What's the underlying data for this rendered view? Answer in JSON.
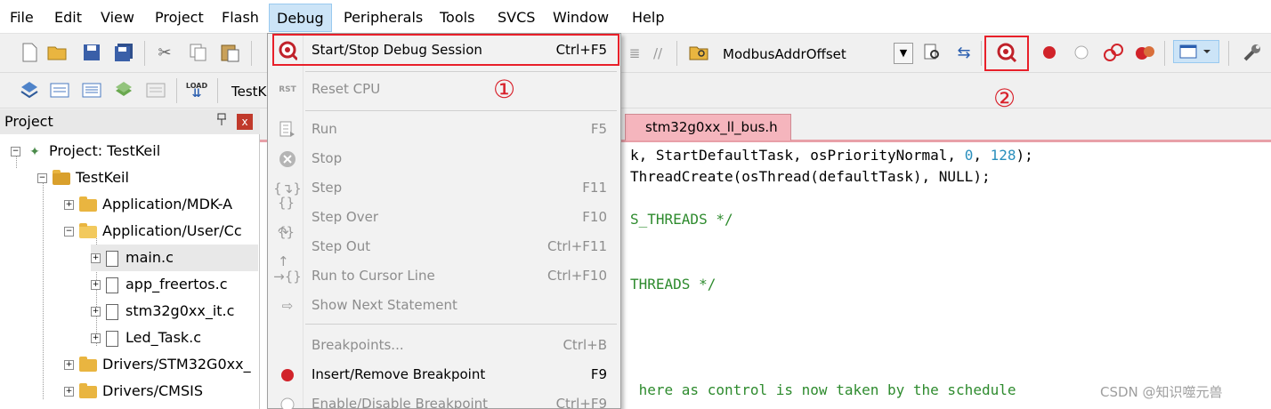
{
  "menubar": {
    "items": [
      "File",
      "Edit",
      "View",
      "Project",
      "Flash",
      "Debug",
      "Peripherals",
      "Tools",
      "SVCS",
      "Window",
      "Help"
    ],
    "active": "Debug"
  },
  "toolbar": {
    "target_combo": "ModbusAddrOffset",
    "build_target": "TestK"
  },
  "annotations": {
    "one": "①",
    "two": "②",
    "color": "#e8202a"
  },
  "debug_menu": {
    "items": [
      {
        "label": "Start/Stop Debug Session",
        "shortcut": "Ctrl+F5",
        "enabled": true,
        "icon": "debug-session-icon"
      },
      {
        "label": "Reset CPU",
        "shortcut": "",
        "enabled": false,
        "icon": "reset-cpu-icon",
        "icon_text": "RST"
      },
      {
        "label": "Run",
        "shortcut": "F5",
        "enabled": false,
        "icon": "run-icon"
      },
      {
        "label": "Stop",
        "shortcut": "",
        "enabled": false,
        "icon": "stop-icon"
      },
      {
        "label": "Step",
        "shortcut": "F11",
        "enabled": false,
        "icon": "step-icon"
      },
      {
        "label": "Step Over",
        "shortcut": "F10",
        "enabled": false,
        "icon": "step-over-icon"
      },
      {
        "label": "Step Out",
        "shortcut": "Ctrl+F11",
        "enabled": false,
        "icon": "step-out-icon"
      },
      {
        "label": "Run to Cursor Line",
        "shortcut": "Ctrl+F10",
        "enabled": false,
        "icon": "run-to-cursor-icon"
      },
      {
        "label": "Show Next Statement",
        "shortcut": "",
        "enabled": false,
        "icon": "show-next-statement-icon"
      },
      {
        "label": "Breakpoints...",
        "shortcut": "Ctrl+B",
        "enabled": false,
        "icon": ""
      },
      {
        "label": "Insert/Remove Breakpoint",
        "shortcut": "F9",
        "enabled": true,
        "icon": "breakpoint-icon"
      },
      {
        "label": "Enable/Disable Breakpoint",
        "shortcut": "Ctrl+F9",
        "enabled": false,
        "icon": "enable-breakpoint-icon"
      }
    ]
  },
  "project_panel": {
    "title": "Project",
    "pin": "ᵽ",
    "close": "x",
    "tree": [
      {
        "label": "Project: TestKeil",
        "level": 0,
        "expander": "−",
        "kind": "project"
      },
      {
        "label": "TestKeil",
        "level": 1,
        "expander": "−",
        "kind": "target"
      },
      {
        "label": "Application/MDK-A",
        "level": 2,
        "expander": "+",
        "kind": "folder"
      },
      {
        "label": "Application/User/Cc",
        "level": 2,
        "expander": "−",
        "kind": "folder-open"
      },
      {
        "label": "main.c",
        "level": 3,
        "expander": "+",
        "kind": "file",
        "selected": true
      },
      {
        "label": "app_freertos.c",
        "level": 3,
        "expander": "+",
        "kind": "file"
      },
      {
        "label": "stm32g0xx_it.c",
        "level": 3,
        "expander": "+",
        "kind": "file"
      },
      {
        "label": "Led_Task.c",
        "level": 3,
        "expander": "+",
        "kind": "file"
      },
      {
        "label": "Drivers/STM32G0xx_",
        "level": 2,
        "expander": "+",
        "kind": "folder"
      },
      {
        "label": "Drivers/CMSIS",
        "level": 2,
        "expander": "+",
        "kind": "folder"
      }
    ]
  },
  "editor": {
    "tab": "stm32g0xx_ll_bus.h",
    "lines": [
      {
        "prefix": "k, StartDefaultTask, osPriorityNormal, ",
        "n1": "0",
        "mid": ", ",
        "n2": "128",
        "suffix": ");"
      },
      {
        "text": "ThreadCreate(osThread(defaultTask), NULL);"
      },
      {
        "text": "S_THREADS */",
        "comment": true
      },
      {
        "text": "THREADS */",
        "comment": true
      },
      {
        "text": " here as control is now taken by the schedule"
      }
    ]
  },
  "watermark": "CSDN @知识噬元兽"
}
